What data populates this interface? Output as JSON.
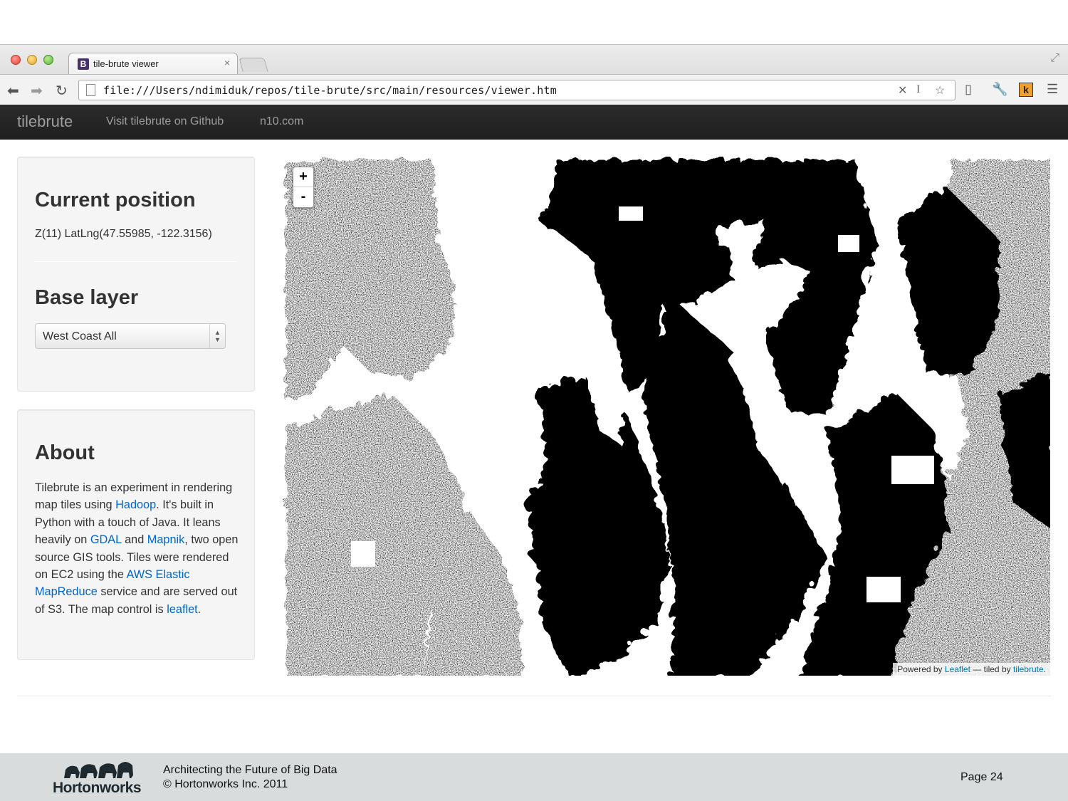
{
  "browser": {
    "tab_title": "tile-brute viewer",
    "tab_favicon": "B",
    "tab_close": "×",
    "url": "file:///Users/ndimiduk/repos/tile-brute/src/main/resources/viewer.htm"
  },
  "navbar": {
    "brand": "tilebrute",
    "links": [
      "Visit tilebrute on Github",
      "n10.com"
    ]
  },
  "position_panel": {
    "title": "Current position",
    "value": "Z(11) LatLng(47.55985, -122.3156)"
  },
  "base_layer_panel": {
    "title": "Base layer",
    "selected": "West Coast All"
  },
  "about_panel": {
    "title": "About",
    "text_1": "Tilebrute is an experiment in rendering map tiles using ",
    "link_hadoop": "Hadoop",
    "text_2": ". It's built in Python with a touch of Java. It leans heavily on ",
    "link_gdal": "GDAL",
    "text_3": " and ",
    "link_mapnik": "Mapnik",
    "text_4": ", two open source GIS tools. Tiles were rendered on EC2 using the ",
    "link_emr": "AWS Elastic MapReduce",
    "text_5": " service and are served out of S3. The map control is ",
    "link_leaflet": "leaflet",
    "text_6": "."
  },
  "map": {
    "zoom_in": "+",
    "zoom_out": "-",
    "attribution_prefix": "Powered by ",
    "attribution_leaflet": "Leaflet",
    "attribution_mid": " — tiled by ",
    "attribution_tilebrute": "tilebrute",
    "attribution_suffix": "."
  },
  "footer": {
    "company": "Hortonworks",
    "line1": "Architecting the Future of Big Data",
    "line2": "© Hortonworks Inc. 2011",
    "page": "Page 24"
  },
  "colors": {
    "link": "#0066cc",
    "navbar_bg": "#222222",
    "footer_bg": "#d9dcdd"
  }
}
